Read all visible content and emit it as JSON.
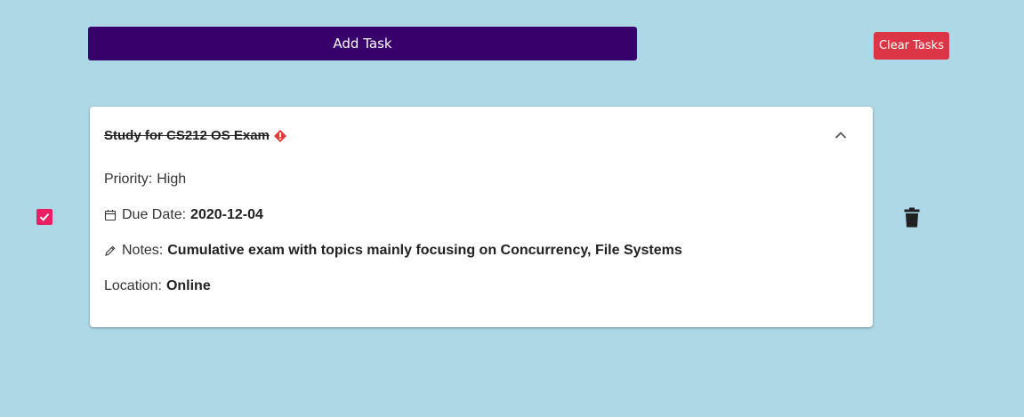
{
  "toolbar": {
    "add_task_label": "Add Task",
    "clear_tasks_label": "Clear Tasks"
  },
  "task": {
    "completed": true,
    "title": "Study for CS212 OS Exam",
    "priority_label": "Priority:",
    "priority_value": "High",
    "due_date_label": "Due Date:",
    "due_date_value": "2020-12-04",
    "notes_label": "Notes:",
    "notes_value": "Cumulative exam with topics mainly focusing on Concurrency, File Systems",
    "location_label": "Location:",
    "location_value": "Online"
  },
  "icons": {
    "priority": "alert-diamond-icon",
    "collapse": "chevron-up-icon",
    "due_date": "calendar-icon",
    "notes": "pencil-icon",
    "delete": "trash-icon",
    "checkbox": "check-icon"
  },
  "colors": {
    "background": "#add8e6",
    "add_task_button": "#37006a",
    "clear_tasks_button": "#dc3545",
    "checkbox": "#e91e63",
    "priority_high": "#e53935"
  }
}
